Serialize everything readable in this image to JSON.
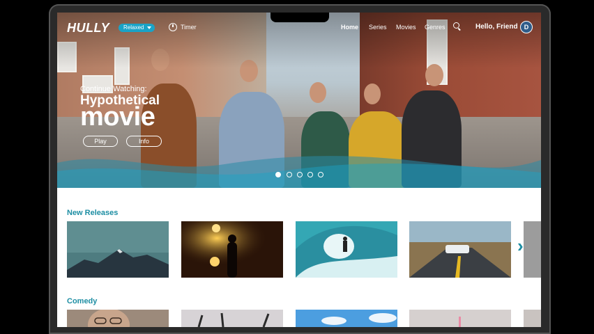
{
  "app": {
    "logo": "HULLY",
    "mood": "Relaxed",
    "timer_label": "Timer"
  },
  "nav": {
    "links": [
      "Home",
      "Series",
      "Movies",
      "Genres"
    ],
    "active": "Home",
    "greeting": "Hello, Friend",
    "avatar_initial": "D"
  },
  "hero": {
    "eyebrow": "Continue Watching:",
    "title_line1": "Hypothetical",
    "title_line2": "movie",
    "play_label": "Play",
    "info_label": "Info",
    "slide_count": 5,
    "active_slide": 1
  },
  "rows": [
    {
      "title": "New Releases",
      "items": [
        "mountain-dusk",
        "silhouette-lights",
        "surfer-wave",
        "car-on-road"
      ]
    },
    {
      "title": "Comedy",
      "items": [
        "woman-glasses",
        "party-hands",
        "sky-clouds",
        "pink-light"
      ]
    }
  ],
  "colors": {
    "accent": "#1aa3c7",
    "row_title": "#1d8ea3"
  }
}
